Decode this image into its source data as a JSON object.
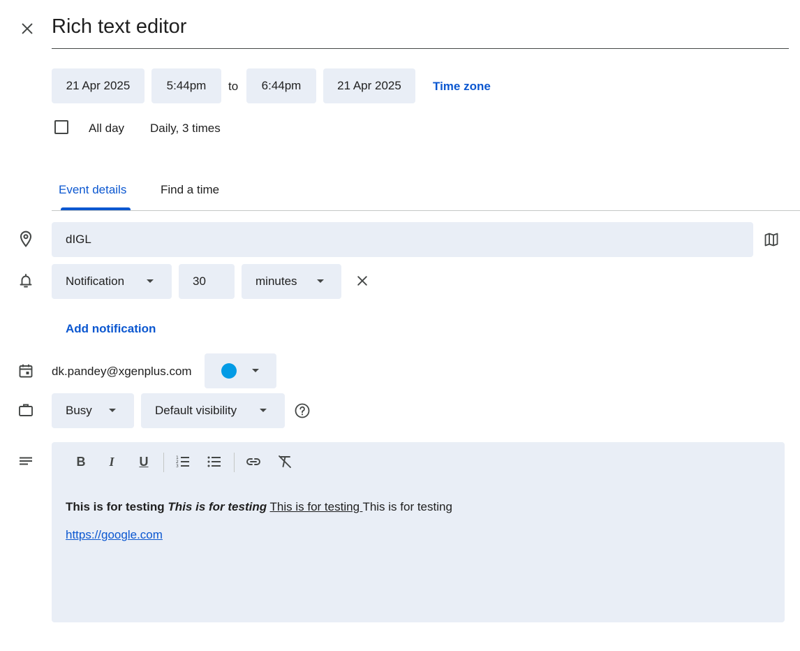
{
  "header": {
    "title": "Rich text editor"
  },
  "date_row": {
    "start_date": "21 Apr 2025",
    "start_time": "5:44pm",
    "to_label": "to",
    "end_time": "6:44pm",
    "end_date": "21 Apr 2025",
    "time_zone_label": "Time zone"
  },
  "options_row": {
    "all_day_label": "All day",
    "all_day_checked": false,
    "recurrence": "Daily, 3 times"
  },
  "tabs": [
    {
      "label": "Event details",
      "active": true
    },
    {
      "label": "Find a time",
      "active": false
    }
  ],
  "location": {
    "value": "dIGL"
  },
  "notification": {
    "type": "Notification",
    "amount": "30",
    "unit": "minutes",
    "add_label": "Add notification"
  },
  "calendar": {
    "owner": "dk.pandey@xgenplus.com",
    "color": "#039be5"
  },
  "availability": {
    "status": "Busy",
    "visibility": "Default visibility"
  },
  "editor": {
    "bold_text": "This is for testing",
    "bold_italic_text": "This is for testing",
    "underline_text": "This is for testing ",
    "plain_text": "This is for testing",
    "link_text": "https://google.com"
  },
  "colors": {
    "accent": "#0b57d0",
    "chip_bg": "#e9eef6",
    "icon": "#444746"
  }
}
